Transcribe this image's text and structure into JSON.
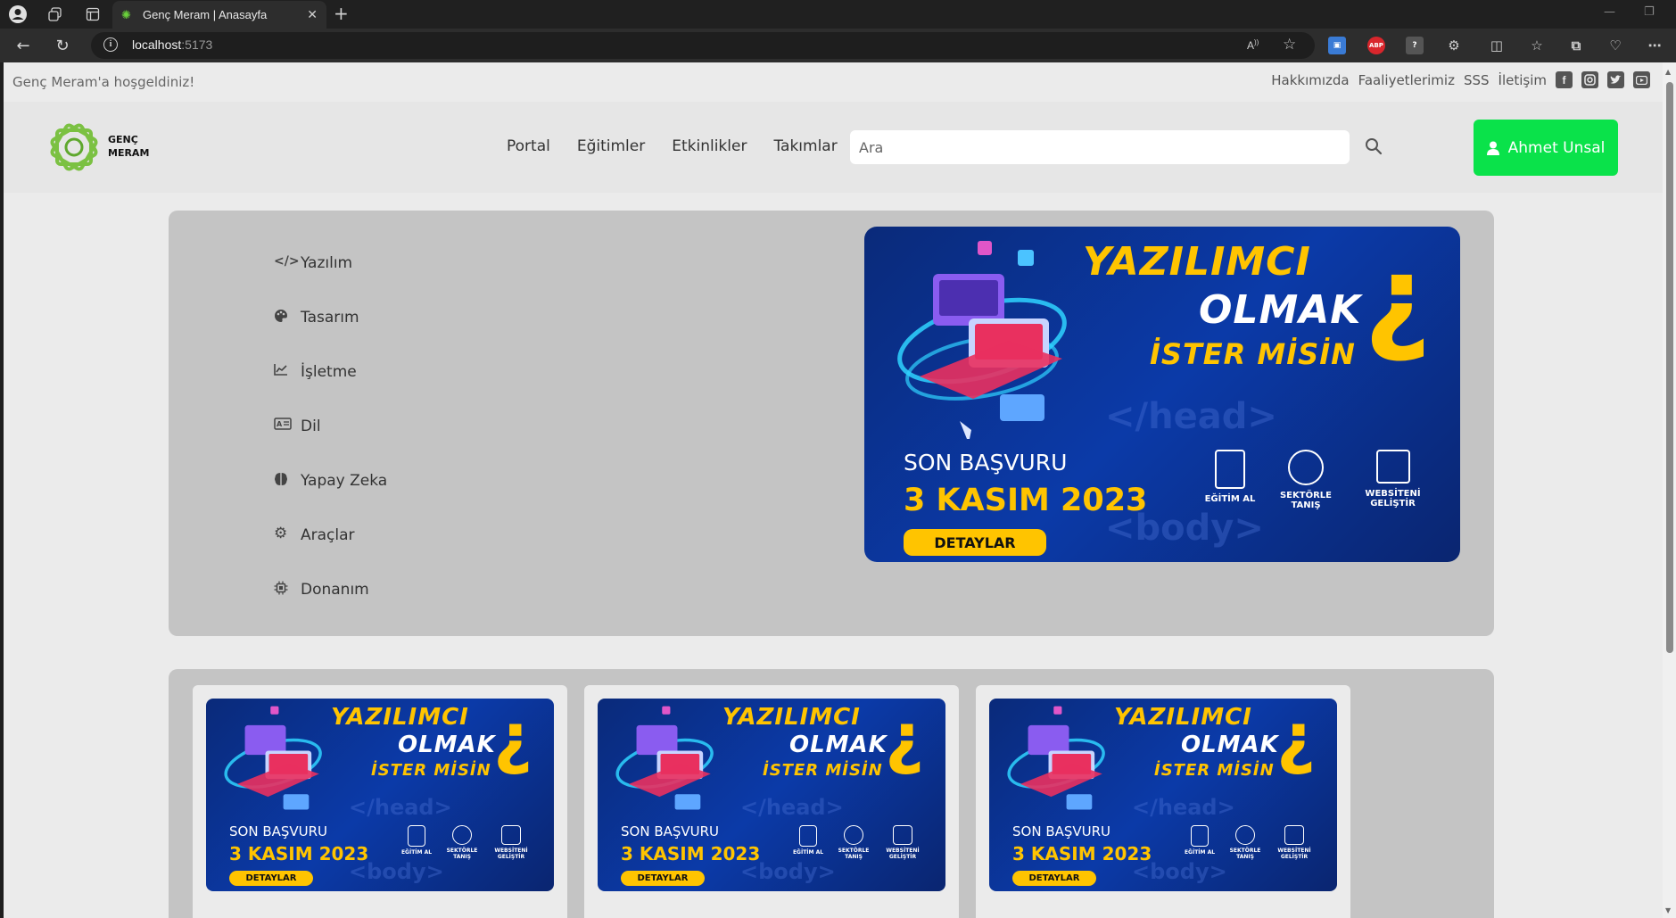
{
  "browser": {
    "tab_title": "Genç Meram | Anasayfa",
    "url_host": "localhost",
    "url_port": ":5173"
  },
  "topbar": {
    "welcome": "Genç Meram'a hoşgeldiniz!",
    "links": [
      "Hakkımızda",
      "Faaliyetlerimiz",
      "SSS",
      "İletişim"
    ],
    "social_icons": [
      "facebook-icon",
      "instagram-icon",
      "twitter-icon",
      "youtube-icon"
    ]
  },
  "header": {
    "logo_line1": "GENÇ",
    "logo_line2": "MERAM",
    "nav": [
      "Portal",
      "Eğitimler",
      "Etkinlikler",
      "Takımlar"
    ],
    "search_placeholder": "Ara",
    "user_name": "Ahmet Unsal",
    "accent": "#0ae24a"
  },
  "categories": [
    {
      "label": "Yazılım",
      "icon": "code-icon"
    },
    {
      "label": "Tasarım",
      "icon": "palette-icon"
    },
    {
      "label": "İşletme",
      "icon": "chart-line-icon"
    },
    {
      "label": "Dil",
      "icon": "language-icon"
    },
    {
      "label": "Yapay Zeka",
      "icon": "brain-icon"
    },
    {
      "label": "Araçlar",
      "icon": "gear-icon"
    },
    {
      "label": "Donanım",
      "icon": "chip-icon"
    }
  ],
  "banner": {
    "line1": "YAZILIMCI",
    "line2": "OLMAK",
    "line3": "İSTER MİSİN",
    "deadline_label": "SON BAŞVURU",
    "deadline_date": "3 KASIM 2023",
    "button": "DETAYLAR",
    "features": [
      "EĞİTİM AL",
      "SEKTÖRLE TANIŞ",
      "WEBSİTENİ GELİŞTİR"
    ],
    "bg_text1": "</head>",
    "bg_text2": "<body>",
    "colors": {
      "navy": "#0b3aa8",
      "yellow": "#ffc400"
    }
  }
}
